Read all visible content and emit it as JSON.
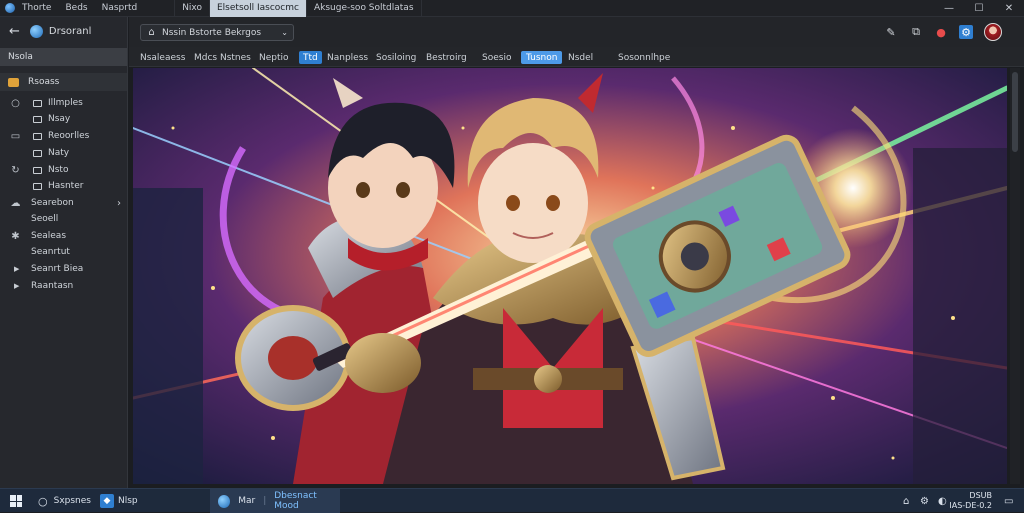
{
  "titlebar": {
    "menu": [
      "Thorte",
      "Beds",
      "Nasprtd"
    ],
    "tabs": [
      {
        "label": "Nixo",
        "active": false
      },
      {
        "label": "Elsetsoll Iascocmc",
        "active": true
      },
      {
        "label": "Aksuge-soo Soltdlatas",
        "active": false
      }
    ]
  },
  "sidebar": {
    "header_title": "Drsoranl",
    "section_label": "Nsola",
    "home_label": "Rsoass",
    "items": [
      {
        "label": "Illmples"
      },
      {
        "label": "Nsay"
      },
      {
        "label": "Reoorlles"
      },
      {
        "label": "Naty"
      },
      {
        "label": "Nsto"
      },
      {
        "label": "Hasnter"
      },
      {
        "label": "Searebon"
      },
      {
        "label": "Seoell"
      },
      {
        "label": "Sealeas"
      },
      {
        "label": "Seanrtut"
      },
      {
        "label": "Seanrt Biea"
      },
      {
        "label": "Raantasn"
      }
    ]
  },
  "toolbar": {
    "address_text": "Nssin Bstorte Bekrgos"
  },
  "bookmarks": [
    "Nsaleaess",
    "Mdcs Nstnes",
    "Neptio",
    "Ttd",
    "Nanpless",
    "Sosiloing",
    "Bestroirg",
    "Soesio",
    "Tusnon",
    "Nsdel",
    "Sosonnlhpe"
  ],
  "taskbar": {
    "search_label": "Sxpsnes",
    "app_label": "Nlsp",
    "window_label": "Mar",
    "window_title": "Dbesnact Mood",
    "tray_time": "DSUB",
    "tray_date": "IAS-DE-0.2"
  },
  "colors": {
    "accent": "#2f7fd1",
    "active_tab": "#c7d1dc",
    "sidebar_bg": "#26282d",
    "taskbar_bg": "#1e2a3c"
  },
  "icons": [
    "back-arrow-icon",
    "globe-icon",
    "lock-icon",
    "chevron-down-icon",
    "extension-icon",
    "share-icon",
    "favorite-icon",
    "settings-icon",
    "windows-icon",
    "search-icon"
  ]
}
